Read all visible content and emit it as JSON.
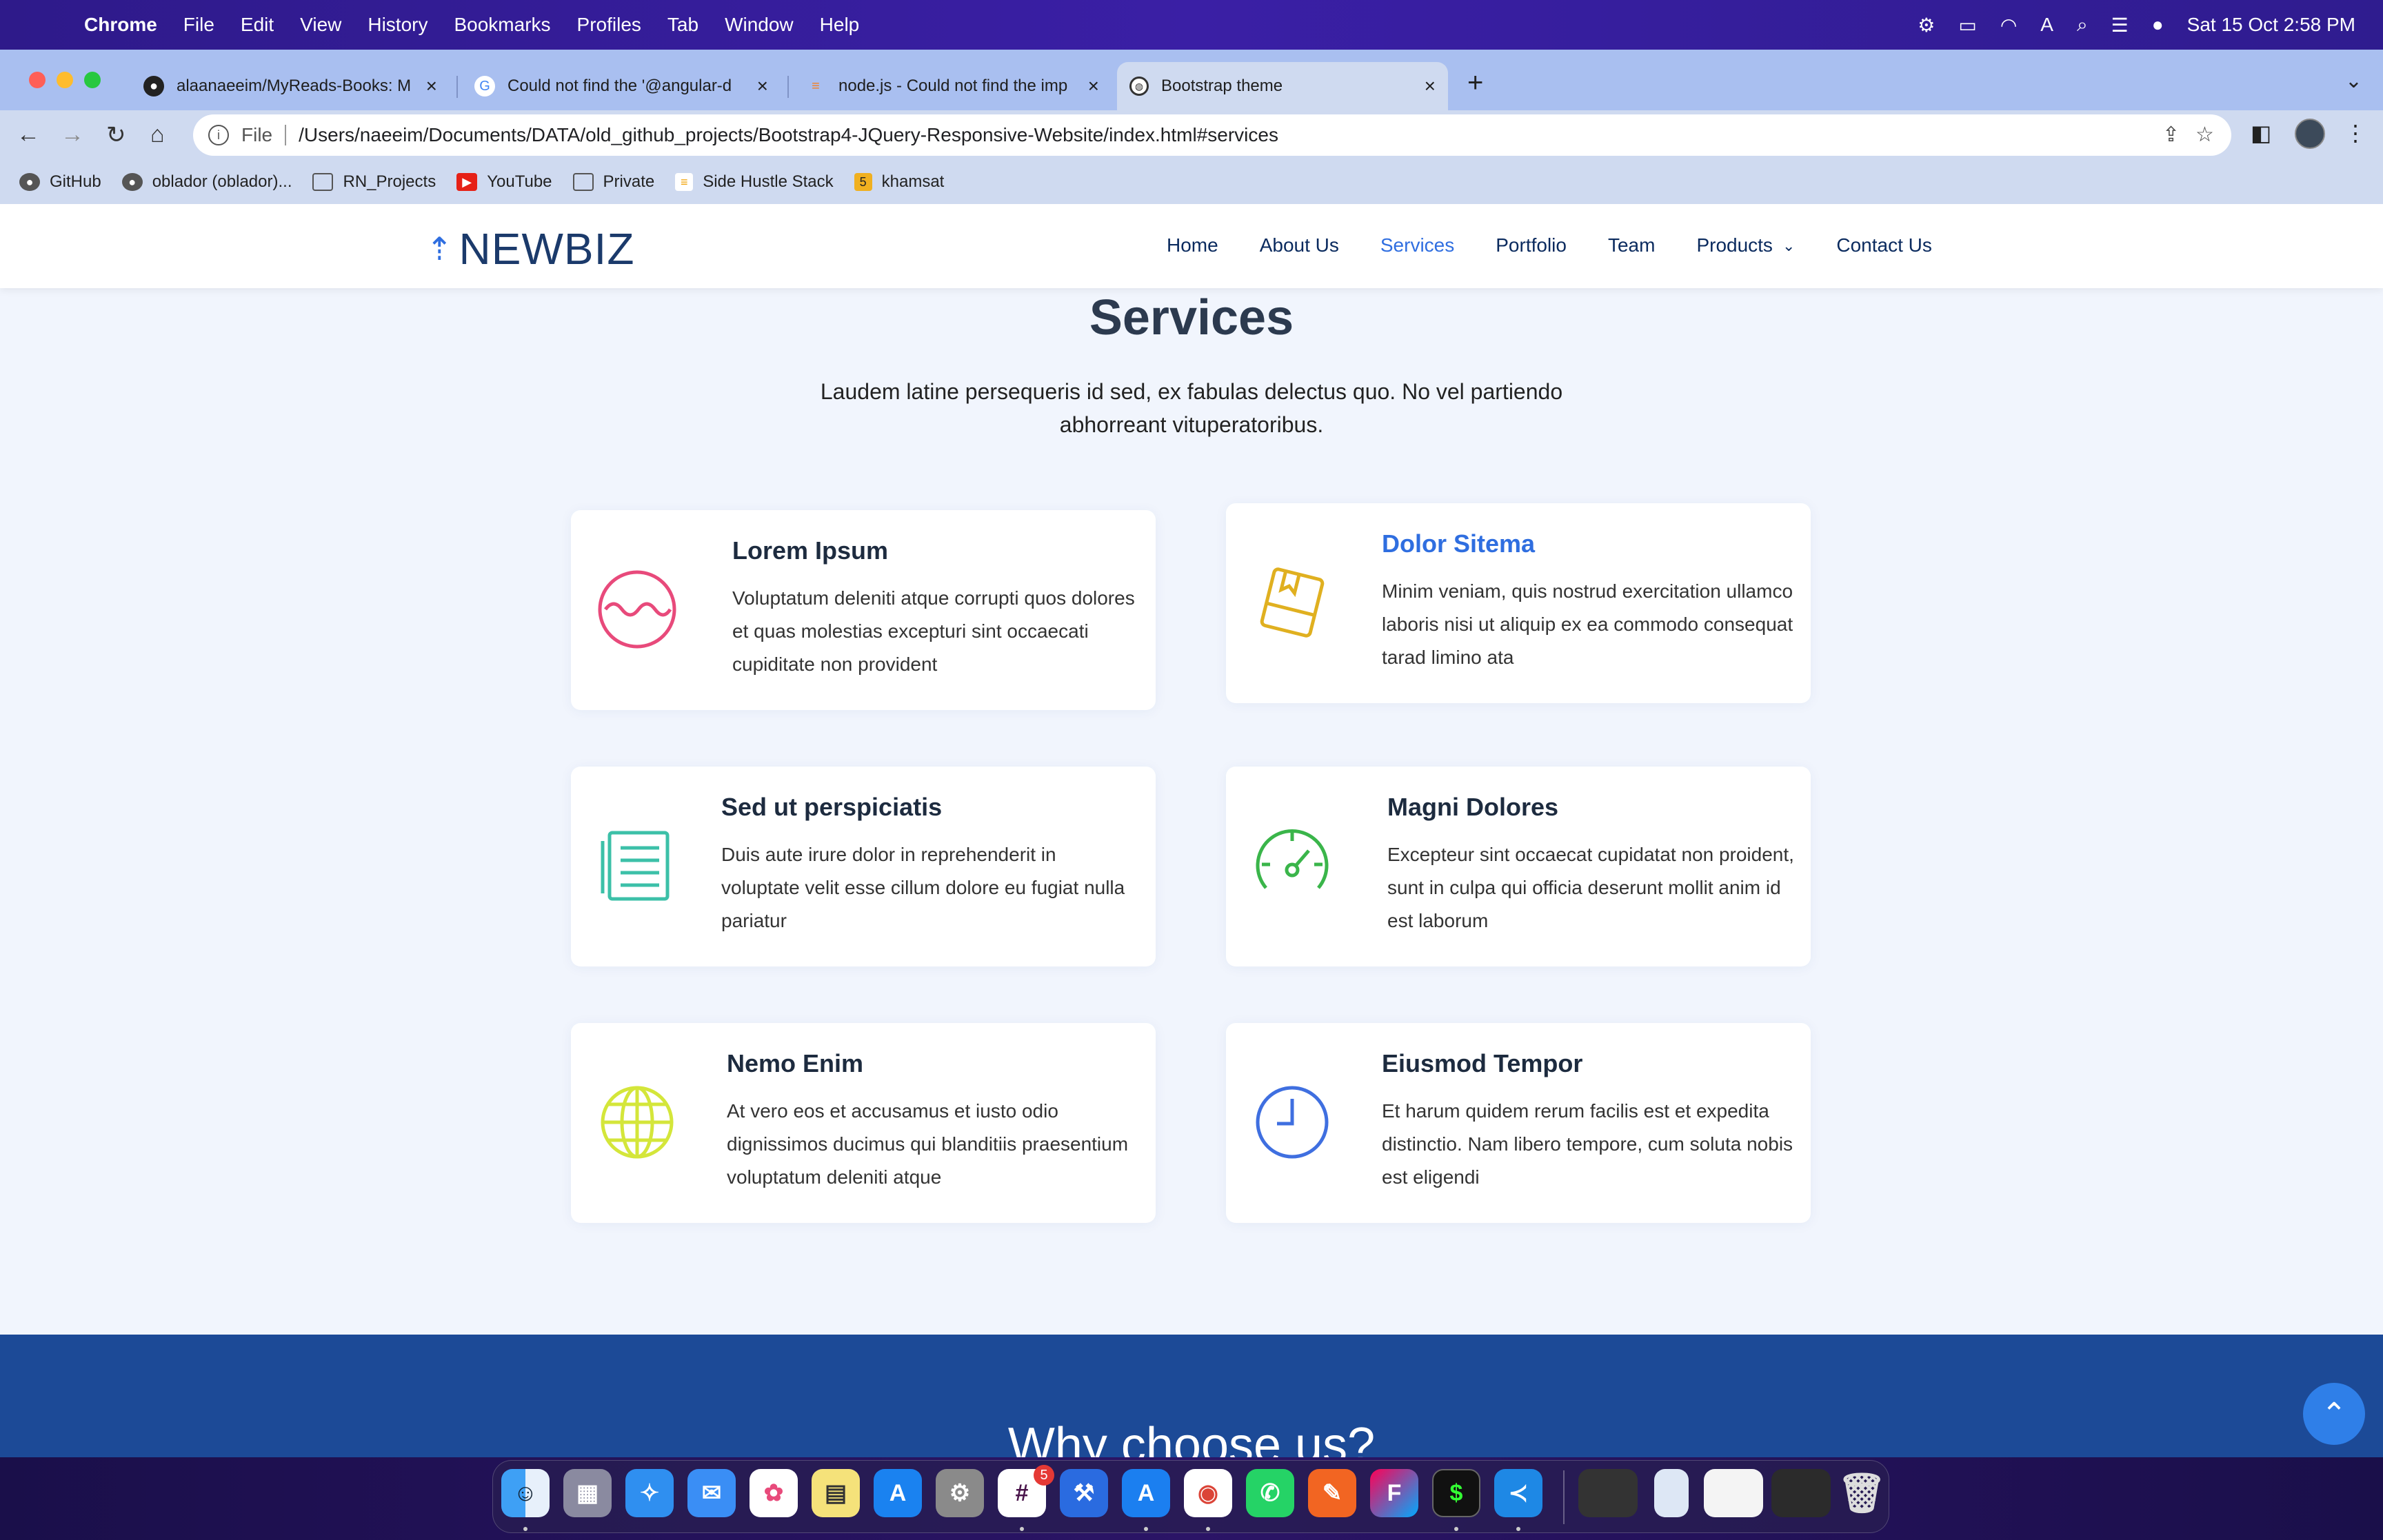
{
  "menubar": {
    "app": "Chrome",
    "items": [
      "File",
      "Edit",
      "View",
      "History",
      "Bookmarks",
      "Profiles",
      "Tab",
      "Window",
      "Help"
    ],
    "datetime": "Sat 15 Oct  2:58 PM"
  },
  "tabs": [
    {
      "title": "alaanaeeim/MyReads-Books: M"
    },
    {
      "title": "Could not find the '@angular-d"
    },
    {
      "title": "node.js - Could not find the imp"
    },
    {
      "title": "Bootstrap theme"
    }
  ],
  "omnibox": {
    "scheme": "File",
    "url": "/Users/naeeim/Documents/DATA/old_github_projects/Bootstrap4-JQuery-Responsive-Website/index.html#services"
  },
  "bookmarks": [
    {
      "label": "GitHub"
    },
    {
      "label": "oblador (oblador)..."
    },
    {
      "label": "RN_Projects"
    },
    {
      "label": "YouTube"
    },
    {
      "label": "Private"
    },
    {
      "label": "Side Hustle Stack"
    },
    {
      "label": "khamsat"
    }
  ],
  "site": {
    "logo": "NEWBIZ",
    "nav": [
      "Home",
      "About Us",
      "Services",
      "Portfolio",
      "Team",
      "Products",
      "Contact Us"
    ]
  },
  "services": {
    "title": "Services",
    "description": "Laudem latine persequeris id sed, ex fabulas delectus quo. No vel partiendo abhorreant vituperatoribus.",
    "cards": [
      {
        "title": "Lorem Ipsum",
        "text": "Voluptatum deleniti atque corrupti quos dolores et quas molestias excepturi sint occaecati cupiditate non provident",
        "icon": "wave-icon",
        "color": "#e84a7b"
      },
      {
        "title": "Dolor Sitema",
        "text": "Minim veniam, quis nostrud exercitation ullamco laboris nisi ut aliquip ex ea commodo consequat tarad limino ata",
        "icon": "book-icon",
        "color": "#e0b020"
      },
      {
        "title": "Sed ut perspiciatis",
        "text": "Duis aute irure dolor in reprehenderit in voluptate velit esse cillum dolore eu fugiat nulla pariatur",
        "icon": "document-icon",
        "color": "#3cc0a8"
      },
      {
        "title": "Magni Dolores",
        "text": "Excepteur sint occaecat cupidatat non proident, sunt in culpa qui officia deserunt mollit anim id est laborum",
        "icon": "speedometer-icon",
        "color": "#3ab54a"
      },
      {
        "title": "Nemo Enim",
        "text": "At vero eos et accusamus et iusto odio dignissimos ducimus qui blanditiis praesentium voluptatum deleniti atque",
        "icon": "globe-icon",
        "color": "#d4e63a"
      },
      {
        "title": "Eiusmod Tempor",
        "text": "Et harum quidem rerum facilis est et expedita distinctio. Nam libero tempore, cum soluta nobis est eligendi",
        "icon": "clock-icon",
        "color": "#3f6fe0"
      }
    ]
  },
  "why": {
    "title": "Why choose us?"
  },
  "dock": {
    "slack_badge": "5"
  }
}
